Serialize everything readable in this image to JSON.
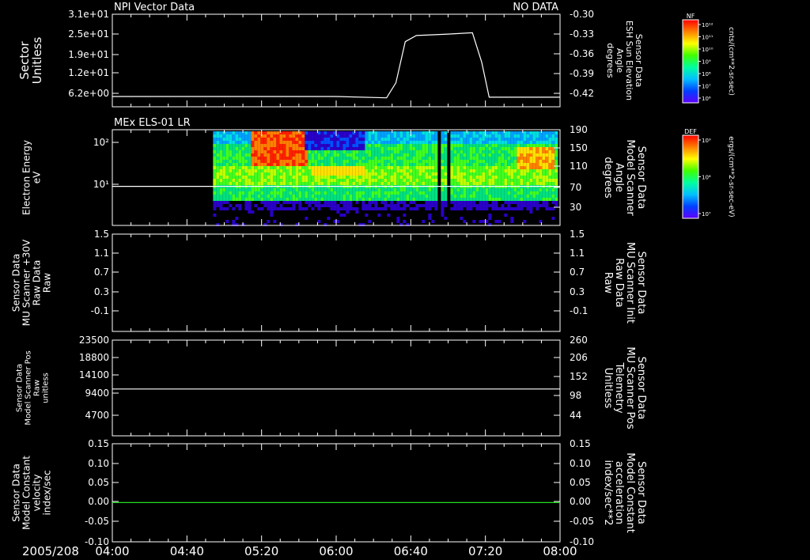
{
  "date_label": "2005/208",
  "x_ticks": [
    "04:00",
    "04:40",
    "05:20",
    "06:00",
    "06:40",
    "07:20",
    "08:00"
  ],
  "colors": {
    "background": "#000000",
    "foreground": "#ffffff",
    "red_label": "#ff2020",
    "green_label": "#22dd22"
  },
  "panels": [
    {
      "id": "p1",
      "title_left": "NPI Vector Data",
      "title_right": "NO DATA",
      "ylabel_left": [
        "Sector",
        "Unitless"
      ],
      "ylabel_right": [
        "Sensor Data",
        "ESH Sun Elevation",
        "Angle",
        "degrees"
      ],
      "left_ticks": [
        "3.1e+01",
        "2.5e+01",
        "1.9e+01",
        "1.2e+01",
        "6.2e+00"
      ],
      "right_ticks": [
        "-0.30",
        "-0.33",
        "-0.36",
        "-0.39",
        "-0.42"
      ],
      "right_color": "#ffffff"
    },
    {
      "id": "p2",
      "title_left": "MEx ELS-01 LR",
      "ylabel_left": [
        "Electron Energy",
        "eV"
      ],
      "ylabel_right": [
        "Sensor Data",
        "Model Scanner",
        "Angle",
        "degrees"
      ],
      "left_ticks": [
        "10²",
        "10¹"
      ],
      "right_ticks": [
        "190",
        "150",
        "110",
        "70",
        "30"
      ],
      "right_color": "#ffffff"
    },
    {
      "id": "p3",
      "ylabel_left": [
        "Sensor Data",
        "MU Scanner +30V",
        "Raw Data",
        "Raw"
      ],
      "ylabel_right": [
        "Sensor Data",
        "MU Scanner Init",
        "Raw Data",
        "Raw"
      ],
      "left_ticks": [
        "1.5",
        "1.1",
        "0.7",
        "0.3",
        "-0.1"
      ],
      "right_ticks": [
        "1.5",
        "1.1",
        "0.7",
        "0.3",
        "-0.1"
      ],
      "right_color": "#ff2020"
    },
    {
      "id": "p4",
      "ylabel_left": [
        "Sensor Data",
        "Model Scanner Pos",
        "Raw",
        "unitless"
      ],
      "ylabel_right": [
        "Sensor Data",
        "MU Scanner Pos",
        "Telemetry",
        "Unitless"
      ],
      "left_ticks": [
        "23500",
        "18800",
        "14100",
        "9400",
        "4700"
      ],
      "right_ticks": [
        "260",
        "206",
        "152",
        "98",
        "44"
      ],
      "right_color": "#ff2020"
    },
    {
      "id": "p5",
      "ylabel_left": [
        "Sensor Data",
        "Model Constant",
        "velocity",
        "index/sec"
      ],
      "ylabel_right": [
        "Sensor Data",
        "Model Constant",
        "acceleration",
        "index/sec**2"
      ],
      "left_ticks": [
        "0.15",
        "0.10",
        "0.05",
        "0.00",
        "-0.05",
        "-0.10"
      ],
      "right_ticks": [
        "0.15",
        "0.10",
        "0.05",
        "0.00",
        "-0.05",
        "-0.10"
      ],
      "right_color": "#22dd22"
    }
  ],
  "colorbars": [
    {
      "id": "cb1",
      "label": "NF",
      "ticks": [
        "10¹²",
        "10¹¹",
        "10¹⁰",
        "10⁹",
        "10⁸",
        "10⁷",
        "10⁶"
      ],
      "unit": "cnts/(cm**2-sr-sec)"
    },
    {
      "id": "cb2",
      "label": "DEF",
      "ticks": [
        "10⁹",
        "10⁸",
        "10⁷"
      ],
      "unit": "ergs/(cm**2-sr-sec-eV)"
    }
  ],
  "chart_data": [
    {
      "type": "line",
      "panel": "p1",
      "series": [
        {
          "axis": "right",
          "x": [
            "04:00",
            "05:00",
            "06:00",
            "06:27",
            "06:32",
            "06:37",
            "06:43",
            "07:00",
            "07:13",
            "07:18",
            "07:22",
            "08:00"
          ],
          "y": [
            -0.42,
            -0.42,
            -0.42,
            -0.422,
            -0.4,
            -0.34,
            -0.331,
            -0.329,
            -0.327,
            -0.37,
            -0.421,
            -0.421
          ]
        }
      ],
      "ylim_right": [
        -0.435,
        -0.3
      ]
    },
    {
      "type": "heatmap",
      "panel": "p2",
      "x_range": [
        "04:54",
        "08:00"
      ],
      "y_log_range_eV": [
        2.5,
        170
      ],
      "features": [
        {
          "x": [
            "05:13",
            "05:44"
          ],
          "level": "high-energy"
        },
        {
          "x": [
            "05:45",
            "06:15"
          ],
          "level": "mid-band"
        }
      ],
      "series": [
        {
          "axis": "left",
          "x": [
            "04:00",
            "08:00"
          ],
          "y": [
            14,
            14
          ]
        }
      ],
      "ylim_right": [
        0,
        190
      ]
    },
    {
      "type": "line",
      "panel": "p3",
      "series": [],
      "ylim": [
        -0.3,
        1.5
      ]
    },
    {
      "type": "line",
      "panel": "p4",
      "series": [
        {
          "axis": "left",
          "x": [
            "04:00",
            "08:00"
          ],
          "y": [
            11500,
            11500
          ]
        }
      ],
      "ylim": [
        0,
        23500
      ]
    },
    {
      "type": "line",
      "panel": "p5",
      "series": [
        {
          "axis": "left",
          "x": [
            "04:00",
            "08:00"
          ],
          "y": [
            0.0,
            0.0
          ],
          "color": "#22dd22"
        }
      ],
      "ylim": [
        -0.1,
        0.15
      ]
    }
  ]
}
